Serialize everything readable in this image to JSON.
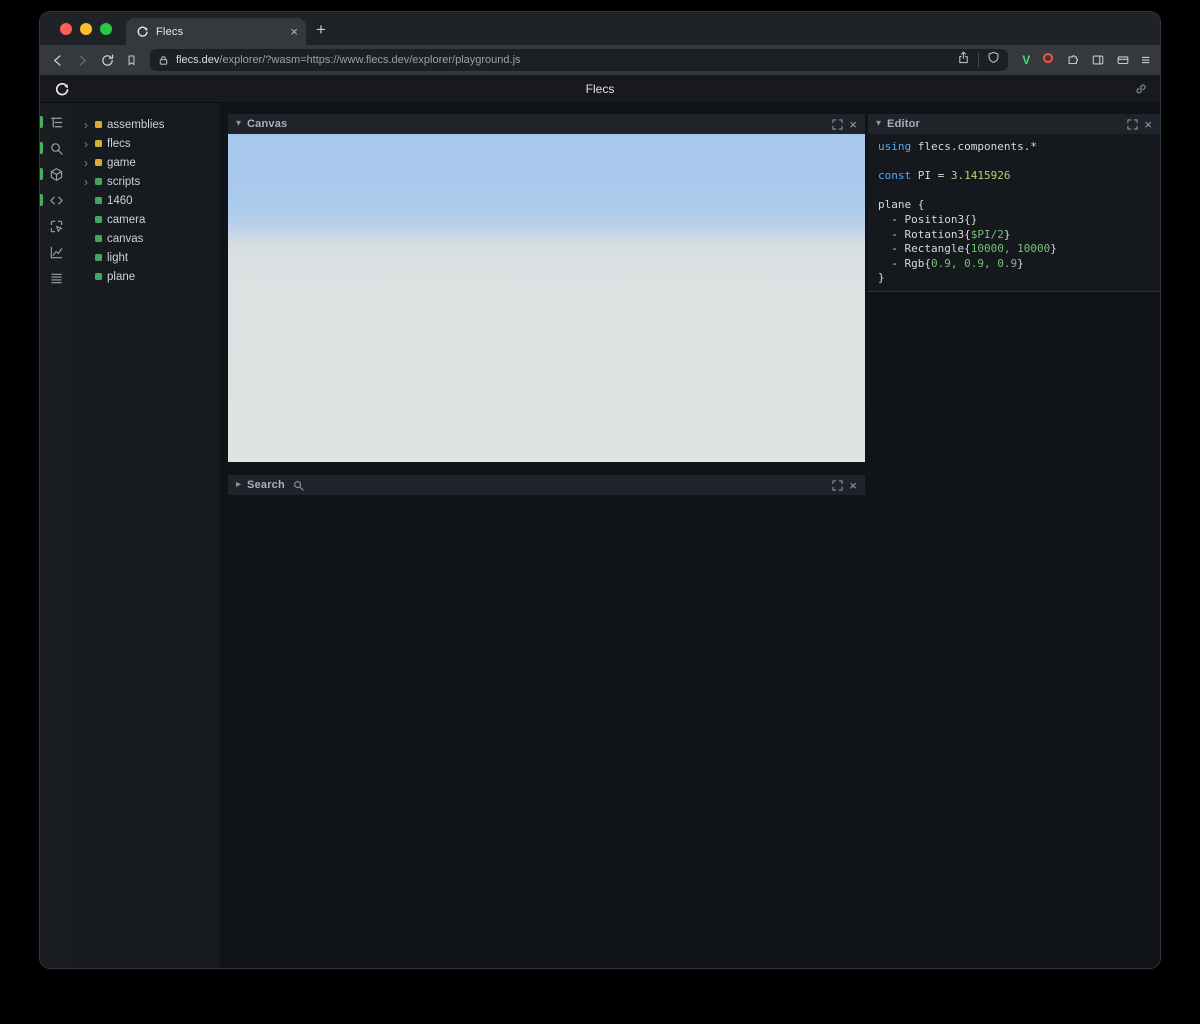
{
  "colors": {
    "accent_green": "#46b05e",
    "module_yellow": "#d4af37",
    "entity_green": "#44a55e",
    "kw_blue": "#55a8f0",
    "num_green": "#74c274",
    "num_yellow": "#c3c878",
    "sky_top": "#a6c7ec",
    "ground_bottom": "#dfe4e2"
  },
  "browser": {
    "tab_title": "Flecs",
    "url_host": "flecs.dev",
    "url_rest": "/explorer/?wasm=https://www.flecs.dev/explorer/playground.js",
    "ext_v": "V"
  },
  "icons": {
    "close": "×",
    "new_tab": "+",
    "chevron_down": "▾",
    "chevron_right": "▸",
    "tree_arrow": "›",
    "menu": "≡"
  },
  "header": {
    "title": "Flecs"
  },
  "tree": {
    "items": [
      {
        "label": "assemblies",
        "kind": "module",
        "expandable": true
      },
      {
        "label": "flecs",
        "kind": "module",
        "expandable": true
      },
      {
        "label": "game",
        "kind": "module",
        "expandable": true
      },
      {
        "label": "scripts",
        "kind": "entity",
        "expandable": true
      },
      {
        "label": "1460",
        "kind": "entity",
        "expandable": false
      },
      {
        "label": "camera",
        "kind": "entity",
        "expandable": false
      },
      {
        "label": "canvas",
        "kind": "entity",
        "expandable": false
      },
      {
        "label": "light",
        "kind": "entity",
        "expandable": false
      },
      {
        "label": "plane",
        "kind": "entity",
        "expandable": false
      }
    ]
  },
  "panels": {
    "canvas": {
      "title": "Canvas"
    },
    "search": {
      "title": "Search"
    },
    "editor": {
      "title": "Editor"
    }
  },
  "editor": {
    "lines": [
      [
        {
          "t": "using ",
          "c": "kw"
        },
        {
          "t": "flecs.components.*",
          "c": "tx"
        }
      ],
      [],
      [
        {
          "t": "const ",
          "c": "kw"
        },
        {
          "t": "PI = ",
          "c": "tx"
        },
        {
          "t": "3.1415926",
          "c": "ny"
        }
      ],
      [],
      [
        {
          "t": "plane {",
          "c": "tx"
        }
      ],
      [
        {
          "t": "  - Position3{}",
          "c": "tx"
        }
      ],
      [
        {
          "t": "  - Rotation3{",
          "c": "tx"
        },
        {
          "t": "$PI/2",
          "c": "nm"
        },
        {
          "t": "}",
          "c": "tx"
        }
      ],
      [
        {
          "t": "  - Rectangle{",
          "c": "tx"
        },
        {
          "t": "10000, 10000",
          "c": "nm"
        },
        {
          "t": "}",
          "c": "tx"
        }
      ],
      [
        {
          "t": "  - Rgb{",
          "c": "tx"
        },
        {
          "t": "0.9, 0.9, 0.9",
          "c": "nm"
        },
        {
          "t": "}",
          "c": "tx"
        }
      ],
      [
        {
          "t": "}",
          "c": "tx"
        }
      ]
    ]
  }
}
